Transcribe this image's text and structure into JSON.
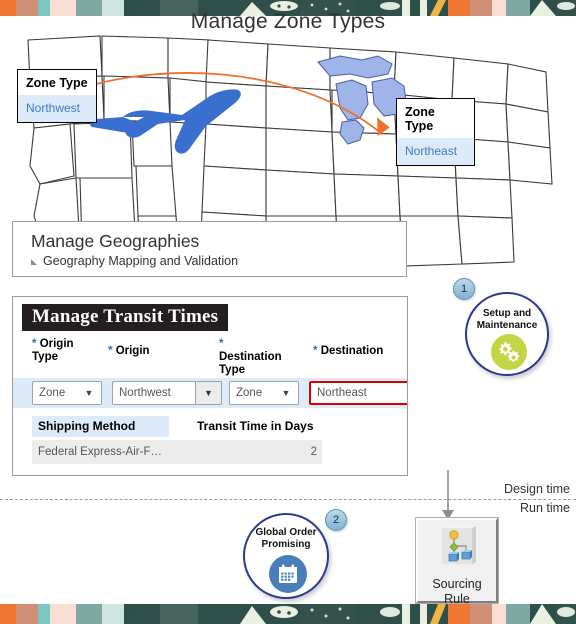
{
  "page": {
    "title": "Manage Zone Types"
  },
  "map": {
    "origin_callout": {
      "header": "Zone Type",
      "value": "Northwest"
    },
    "destination_callout": {
      "header": "Zone Type",
      "value": "Northeast"
    },
    "plane_icon": "airplane-icon",
    "route_arrow_color": "#f1702a",
    "lakes_color": "#9fb4e8"
  },
  "geographies_panel": {
    "title": "Manage Geographies",
    "subsection": "Geography Mapping and Validation",
    "expander_icon": "triangle-collapse-icon"
  },
  "transit_panel": {
    "title": "Manage Transit Times",
    "required_marker": "*",
    "fields": [
      {
        "label": "Origin Type",
        "value": "Zone",
        "control": "select"
      },
      {
        "label": "Origin",
        "value": "Northwest",
        "control": "lov"
      },
      {
        "label": "Destination Type",
        "value": "Zone",
        "control": "select"
      },
      {
        "label": "Destination",
        "value": "Northeast",
        "control": "text",
        "highlight": "#d70000"
      }
    ],
    "table": {
      "columns": [
        "Shipping Method",
        "Transit Time in Days"
      ],
      "rows": [
        {
          "shipping_method": "Federal Express-Air-F…",
          "transit_time_days": "2"
        }
      ]
    }
  },
  "steps": {
    "setup": {
      "number": "1",
      "label_line1": "Setup and",
      "label_line2": "Maintenance",
      "icon": "gears-icon",
      "icon_bg": "#c2d645",
      "ring_color": "#2b3990"
    },
    "gop": {
      "number": "2",
      "label_line1": "Global Order",
      "label_line2": "Promising",
      "icon": "calendar-icon",
      "icon_bg": "#4a7ebb",
      "ring_color": "#2b3990"
    }
  },
  "divider": {
    "above_label": "Design time",
    "below_label": "Run time"
  },
  "sourcing_rule": {
    "label_line1": "Sourcing",
    "label_line2": "Rule",
    "icon": "sourcing-rule-tree-icon"
  }
}
